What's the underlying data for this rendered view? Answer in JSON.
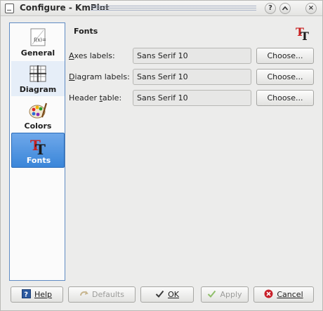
{
  "window": {
    "title": "Configure - KmPlot"
  },
  "titlebar_buttons": {
    "help": "?",
    "minimize": "^",
    "close": "×"
  },
  "sidebar": {
    "items": [
      {
        "label": "General",
        "icon": "general-icon"
      },
      {
        "label": "Diagram",
        "icon": "diagram-icon"
      },
      {
        "label": "Colors",
        "icon": "colors-icon"
      },
      {
        "label": "Fonts",
        "icon": "fonts-icon"
      }
    ],
    "selected": "Fonts"
  },
  "page": {
    "title": "Fonts",
    "rows": [
      {
        "label_accel": "A",
        "label_rest": "xes labels:",
        "value": "Sans Serif 10",
        "button": "Choose..."
      },
      {
        "label_accel": "D",
        "label_rest": "iagram labels:",
        "value": "Sans Serif 10",
        "button": "Choose..."
      },
      {
        "label_pre": "Header ",
        "label_accel": "t",
        "label_rest": "able:",
        "value": "Sans Serif 10",
        "button": "Choose..."
      }
    ]
  },
  "footer": {
    "help": "Help",
    "defaults": "Defaults",
    "ok": "OK",
    "apply": "Apply",
    "cancel": "Cancel"
  },
  "colors": {
    "selection": "#3a86d9",
    "accent_border": "#5f8bc3",
    "cancel_icon": "#c8202a",
    "apply_icon": "#8fbf6a"
  }
}
